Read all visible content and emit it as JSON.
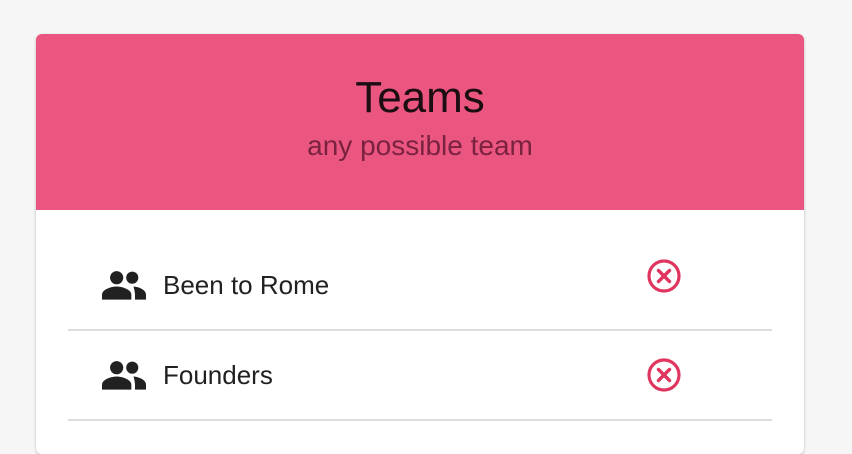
{
  "card": {
    "title": "Teams",
    "subtitle": "any possible team",
    "header_color": "#ea5680"
  },
  "teams": [
    {
      "name": "Been to Rome",
      "icon": "group-icon",
      "action_icon": "remove-circle-icon"
    },
    {
      "name": "Founders",
      "icon": "group-icon",
      "action_icon": "remove-circle-icon"
    }
  ],
  "colors": {
    "accent": "#e0355f",
    "text": "#212121",
    "divider": "#dcdcdc"
  }
}
